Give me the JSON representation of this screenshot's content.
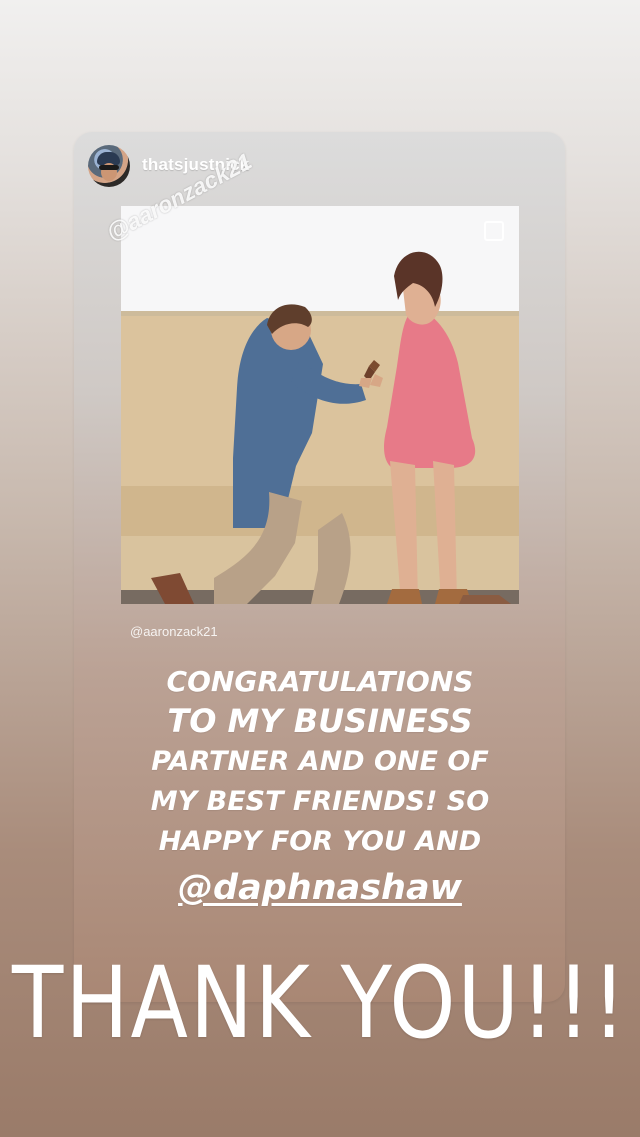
{
  "story": {
    "username": "thatsjustnick",
    "photo_tag": "@aaronzack21",
    "photo_credit": "@aaronzack21",
    "caption_lines": [
      "CONGRATULATIONS",
      "TO MY BUSINESS",
      "PARTNER AND ONE OF",
      "MY BEST FRIENDS! SO",
      "HAPPY FOR YOU AND",
      "@daphnashaw"
    ],
    "thanks": "THANK YOU!!!"
  },
  "icons": {
    "avatar": "profile-avatar",
    "overlay": "square-icon"
  },
  "colors": {
    "background_top": "#f1f0ef",
    "background_bottom": "#9a7b69",
    "text": "#ffffff"
  }
}
